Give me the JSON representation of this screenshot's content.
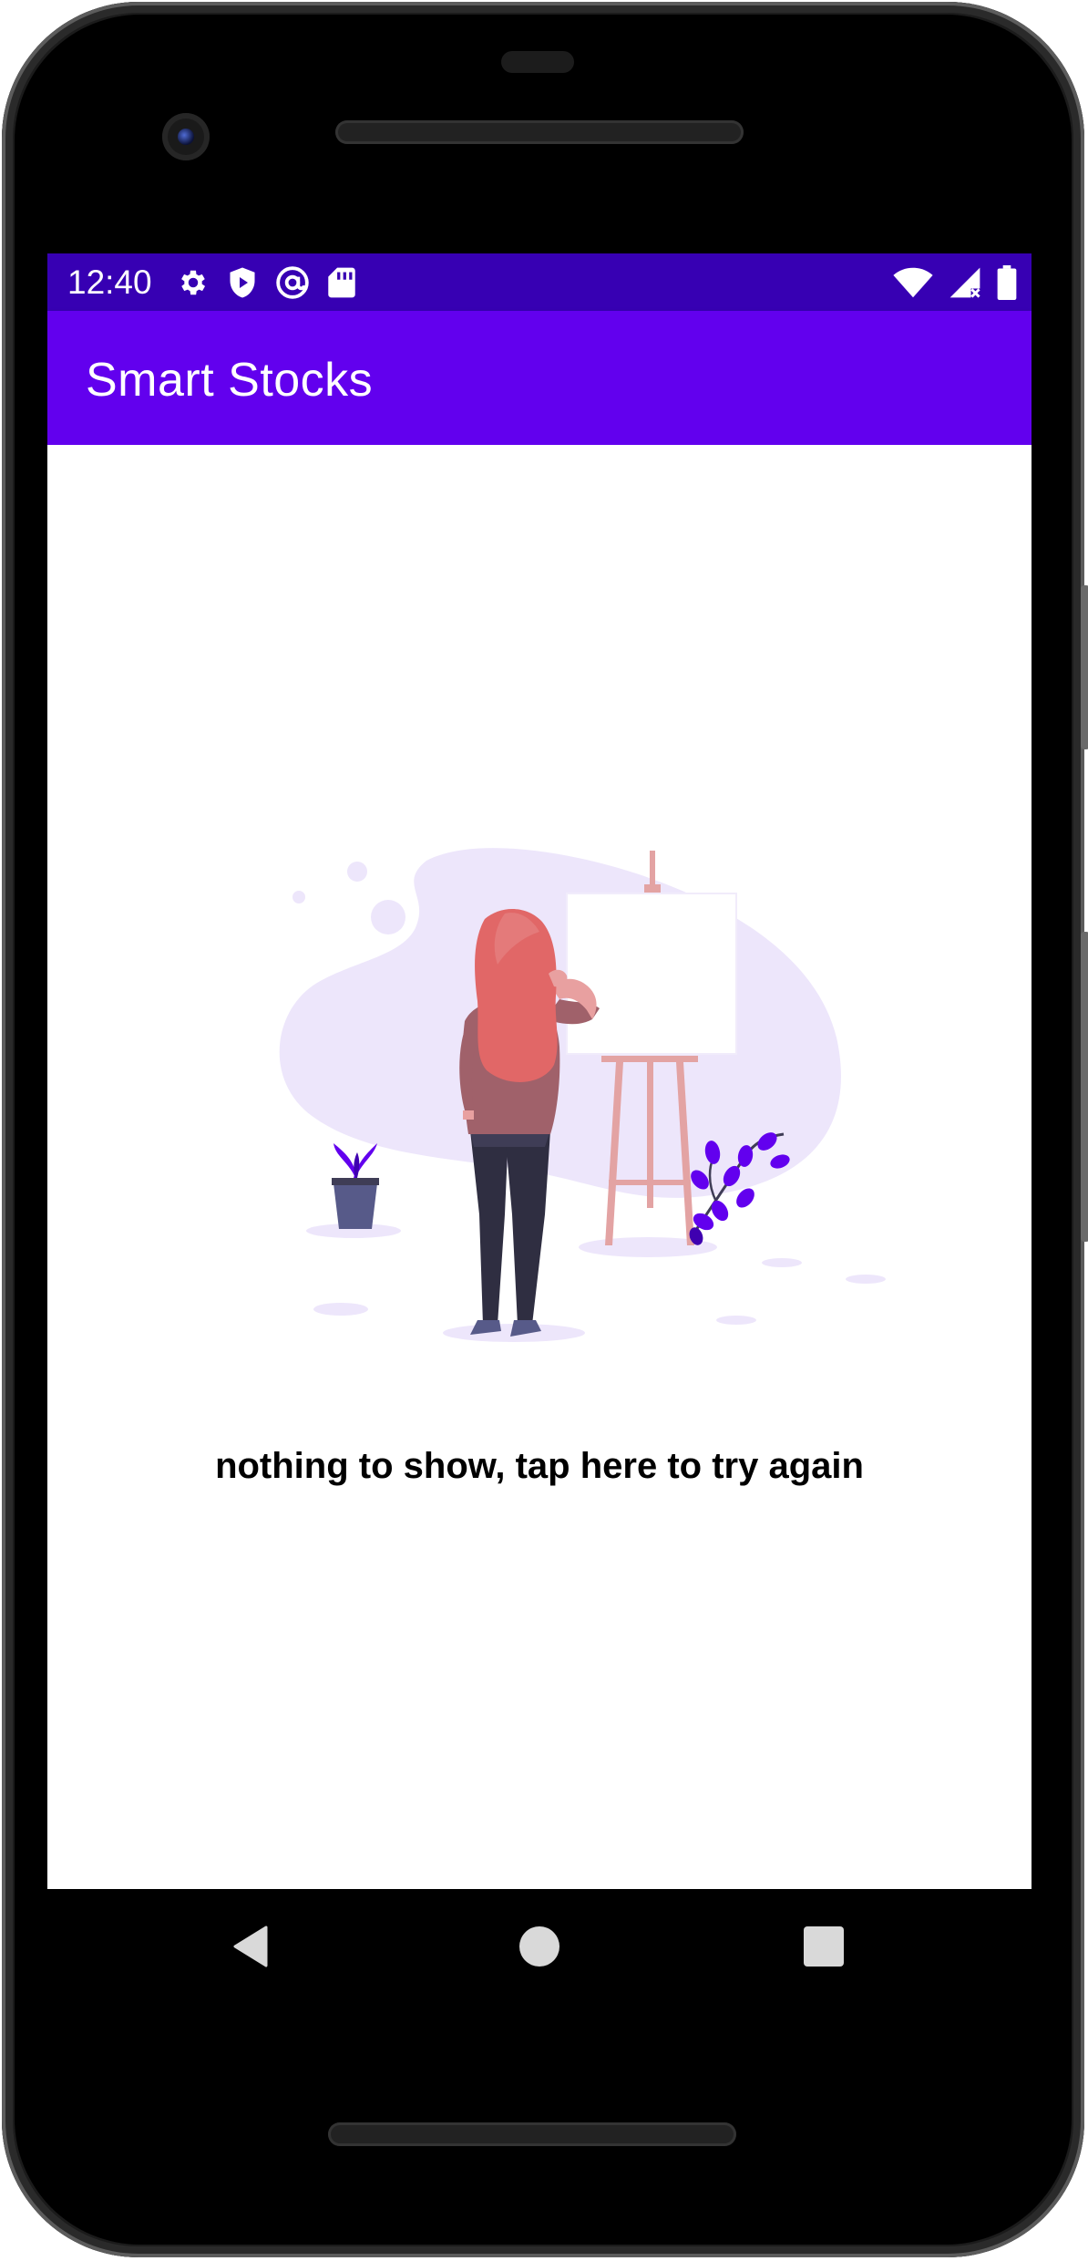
{
  "status_bar": {
    "time": "12:40",
    "left_icons": [
      "settings-gear-icon",
      "play-protect-icon",
      "at-sign-icon",
      "sd-card-icon"
    ],
    "right_icons": [
      "wifi-icon",
      "cellular-signal-icon",
      "battery-icon"
    ]
  },
  "app_bar": {
    "title": "Smart Stocks"
  },
  "empty_state": {
    "illustration": "woman-at-easel-illustration",
    "message": "nothing to show, tap here to try again"
  },
  "navigation": {
    "buttons": [
      "back",
      "home",
      "recents"
    ]
  },
  "colors": {
    "status_bar": "#3700b3",
    "app_bar": "#6200ee",
    "accent": "#6c3cf0",
    "background": "#ffffff"
  }
}
